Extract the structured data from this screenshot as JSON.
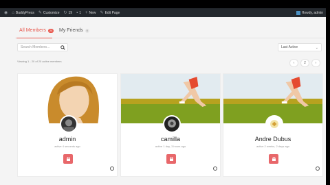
{
  "adminbar": {
    "site": "BuddyPress",
    "customize": "Customize",
    "updates": "19",
    "comments": "1",
    "new": "New",
    "edit": "Edit Page",
    "howdy": "Howdy, admin"
  },
  "tabs": [
    {
      "label": "All Members",
      "count": "24"
    },
    {
      "label": "My Friends",
      "count": "0"
    }
  ],
  "search": {
    "placeholder": "Search Members..."
  },
  "orderby": {
    "selected": "Last Active"
  },
  "viewing": "Viewing 1 - 20 of 20 active members",
  "pagination": {
    "prev": "‹",
    "page": "2",
    "next": "›"
  },
  "members": [
    {
      "name": "admin",
      "active": "active 4 seconds ago"
    },
    {
      "name": "camilla",
      "active": "active 1 day, 3 hours ago"
    },
    {
      "name": "Andre Dubus",
      "active": "active 2 weeks, 2 days ago"
    }
  ],
  "colors": {
    "accent": "#e8574d",
    "action_button": "#e8676a",
    "adminbar": "#23282d"
  }
}
